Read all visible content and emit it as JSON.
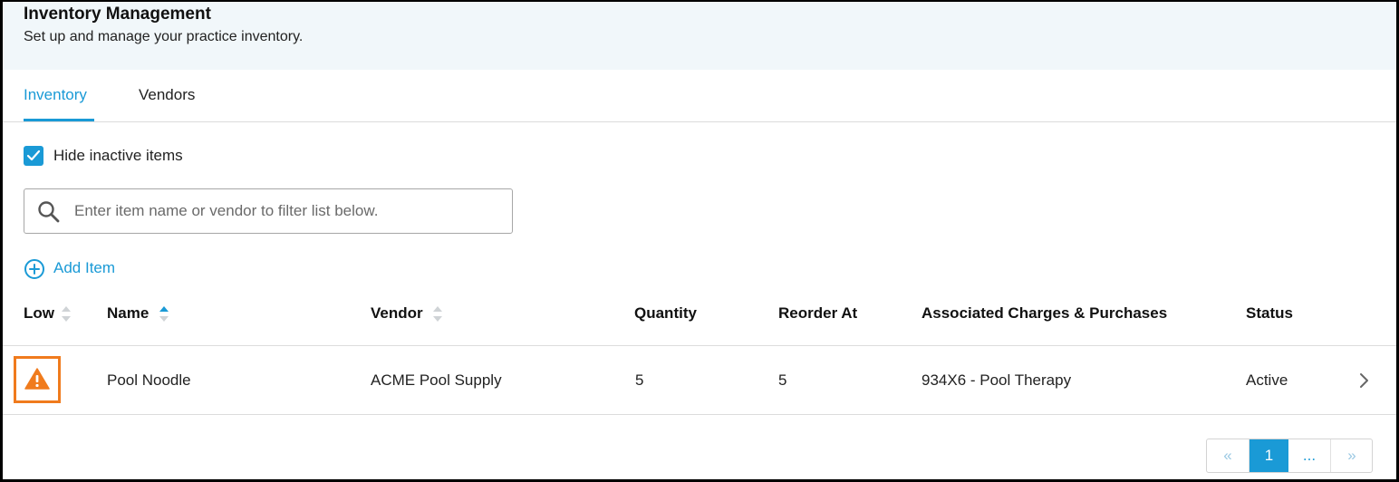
{
  "header": {
    "title": "Inventory Management",
    "subtitle": "Set up and manage your practice inventory."
  },
  "tabs": [
    {
      "label": "Inventory",
      "active": true
    },
    {
      "label": "Vendors",
      "active": false
    }
  ],
  "filters": {
    "hide_inactive_label": "Hide inactive items",
    "hide_inactive_checked": true
  },
  "search": {
    "placeholder": "Enter item name or vendor to filter list below.",
    "value": ""
  },
  "actions": {
    "add_item_label": "Add Item"
  },
  "table": {
    "columns": [
      {
        "label": "Low",
        "sort": "none"
      },
      {
        "label": "Name",
        "sort": "ascending"
      },
      {
        "label": "Vendor",
        "sort": "none"
      },
      {
        "label": "Quantity"
      },
      {
        "label": "Reorder At"
      },
      {
        "label": "Associated Charges & Purchases"
      },
      {
        "label": "Status"
      }
    ],
    "rows": [
      {
        "low_icon": "warning-icon",
        "name": "Pool Noodle",
        "vendor": "ACME Pool Supply",
        "quantity": "5",
        "reorder_at": "5",
        "associated": "934X6 - Pool Therapy",
        "status": "Active"
      }
    ]
  },
  "pagination": {
    "first": "«",
    "current": "1",
    "more": "...",
    "last": "»"
  },
  "colors": {
    "accent": "#1a9ad6",
    "warning": "#f07b1d",
    "header_bg": "#f1f7fa"
  }
}
